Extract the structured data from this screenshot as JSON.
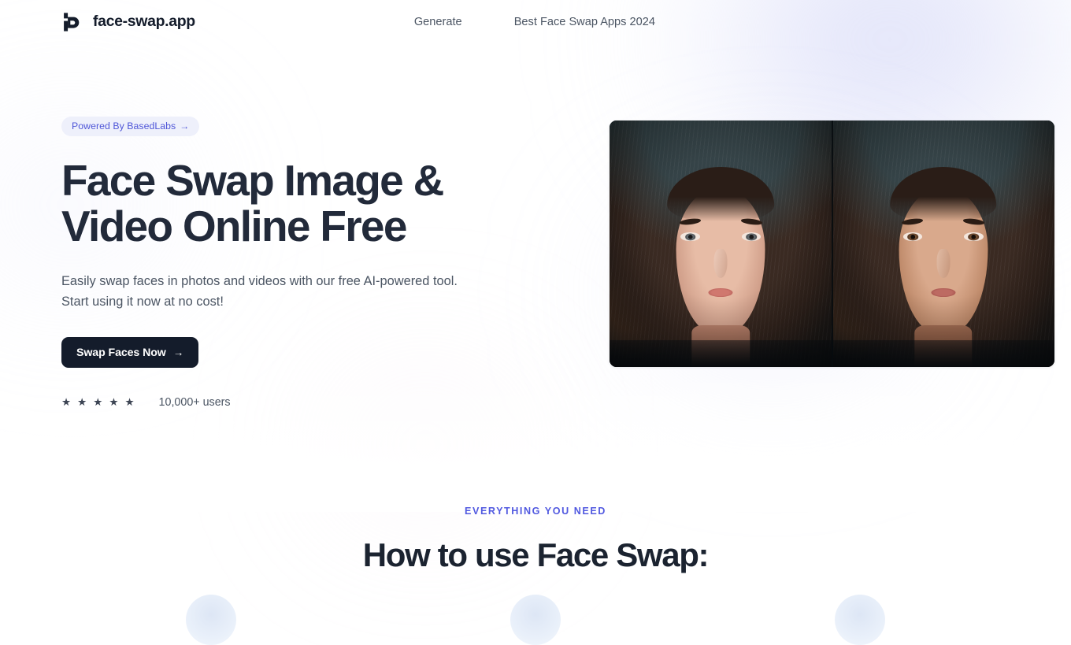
{
  "header": {
    "logo_icon": "basedlabs-b-logo-icon",
    "brand_name": "face-swap.app",
    "nav": [
      {
        "label": "Generate"
      },
      {
        "label": "Best Face Swap Apps 2024"
      }
    ]
  },
  "hero": {
    "badge": {
      "label": "Powered By BasedLabs",
      "arrow": "→"
    },
    "headline_line1": "Face Swap Image &",
    "headline_line2": "Video Online Free",
    "subtitle_line1": "Easily swap faces in photos and videos with our free AI-powered tool.",
    "subtitle_line2": "Start using it now at no cost!",
    "cta": {
      "label": "Swap Faces Now",
      "arrow": "→"
    },
    "social_proof": {
      "stars": [
        "★",
        "★",
        "★",
        "★",
        "★"
      ],
      "rating_count": 5,
      "users_label": "10,000+ users"
    },
    "media": {
      "type": "before-after-face-swap",
      "left_caption": "original face photo",
      "right_caption": "swapped face result"
    }
  },
  "features": {
    "eyebrow": "EVERYTHING YOU NEED",
    "heading": "How to use Face Swap:",
    "steps": [
      {
        "icon": "step-circle-1-icon"
      },
      {
        "icon": "step-circle-2-icon"
      },
      {
        "icon": "step-circle-3-icon"
      }
    ]
  },
  "theme": {
    "ink": "#222a3a",
    "ink_strong": "#141c2b",
    "body_text": "#4b5563",
    "accent_indigo": "#5159e0",
    "badge_bg": "#eef0fb",
    "badge_text": "#4f56d8",
    "page_bg": "#ffffff"
  }
}
